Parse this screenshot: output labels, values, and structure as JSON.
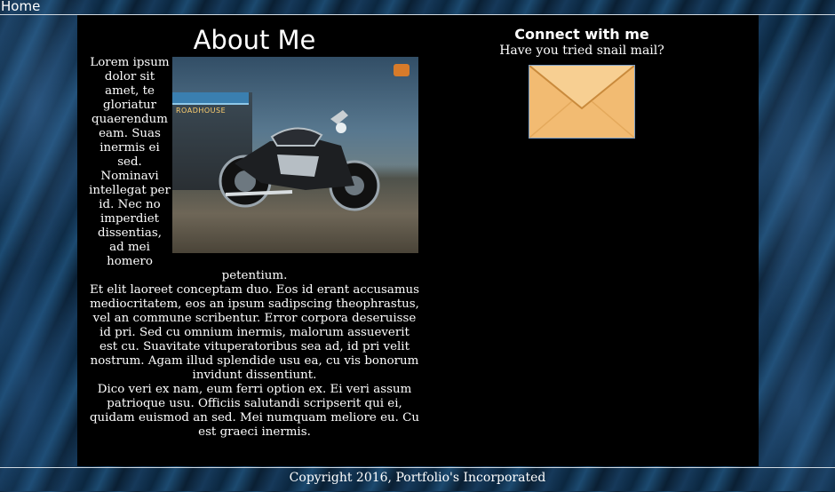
{
  "nav": {
    "home_label": "Home"
  },
  "about": {
    "title": "About Me",
    "paragraph1": "Lorem ipsum dolor sit amet, te gloriatur quaerendum eam. Suas inermis ei sed. Nominavi intellegat per id. Nec no imperdiet dissentias, ad mei homero petentium.",
    "paragraph2": "Et elit laoreet conceptam duo. Eos id erant accusamus mediocritatem, eos an ipsum sadipscing theophrastus, vel an commune scribentur. Error corpora deseruisse id pri. Sed cu omnium inermis, malorum assueverit est cu. Suavitate vituperatoribus sea ad, id pri velit nostrum. Agam illud splendide usu ea, cu vis bonorum invidunt dissentiunt.",
    "paragraph3": "Dico veri ex nam, eum ferri option ex. Ei veri assum patrioque usu. Officiis salutandi scripserit qui ei, quidam euismod an sed. Mei numquam meliore eu. Cu est graeci inermis.",
    "photo": {
      "sign_text": "ROADHOUSE"
    }
  },
  "connect": {
    "title": "Connect with me",
    "subtitle": "Have you tried snail mail?",
    "icon": "envelope-icon"
  },
  "footer": {
    "copyright": "Copyright 2016, Portfolio's Incorporated"
  },
  "colors": {
    "panel_bg": "#000000",
    "envelope_fill": "#f2bb72",
    "envelope_border": "#7d9fc5"
  }
}
